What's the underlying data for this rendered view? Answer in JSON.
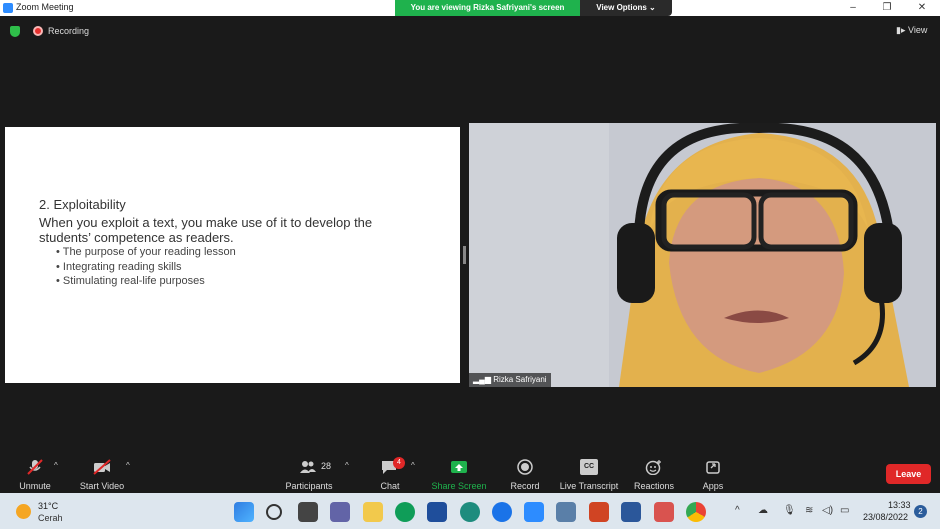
{
  "window": {
    "title": "Zoom Meeting"
  },
  "banner": {
    "text": "You are viewing Rizka Safriyani's screen",
    "view_options": "View Options ⌄"
  },
  "status": {
    "recording": "Recording",
    "view": "View"
  },
  "slide": {
    "heading": "2. Exploitability",
    "body": "When you exploit a text, you make use of it to develop the students’ competence as readers.",
    "bullets": [
      "The purpose of your reading lesson",
      "Integrating reading skills",
      "Stimulating real-life purposes"
    ]
  },
  "participant": {
    "name": "Rizka Safriyani"
  },
  "controls": {
    "unmute": "Unmute",
    "start_video": "Start Video",
    "participants": "Participants",
    "participants_count": "28",
    "chat": "Chat",
    "chat_badge": "4",
    "share_screen": "Share Screen",
    "record": "Record",
    "live_transcript": "Live Transcript",
    "cc": "CC",
    "reactions": "Reactions",
    "apps": "Apps",
    "leave": "Leave"
  },
  "taskbar": {
    "weather_temp": "31°C",
    "weather_cond": "Cerah",
    "time": "13:33",
    "date": "23/08/2022",
    "notifications": "2"
  },
  "colors": {
    "share_green": "#1fb24d",
    "leave_red": "#e02828",
    "zoom_blue": "#2d8cff"
  }
}
